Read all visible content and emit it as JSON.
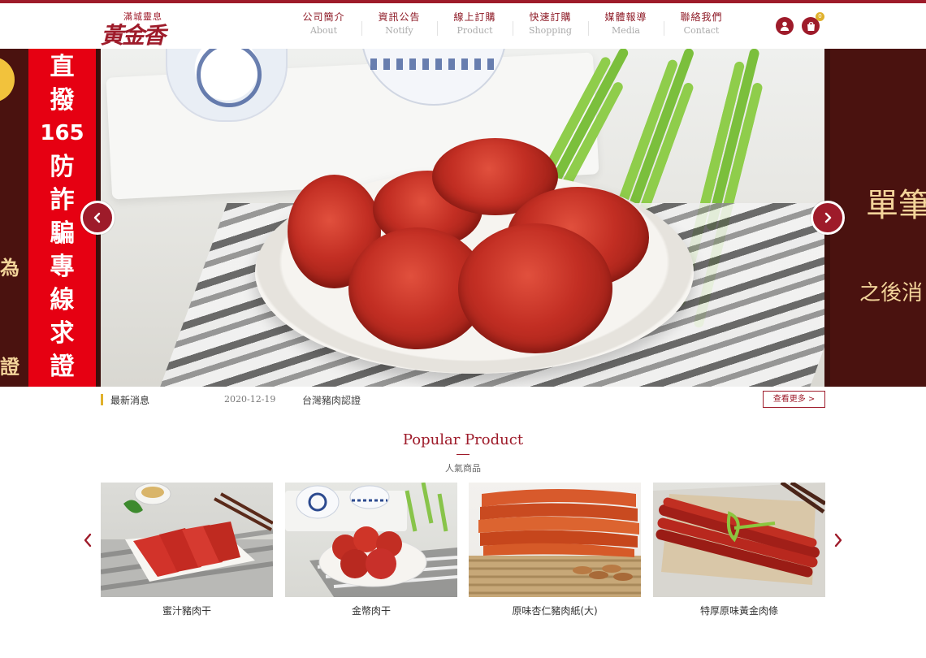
{
  "brand": {
    "small": "滿城靈息",
    "name": "黃金香"
  },
  "nav": [
    {
      "zh": "公司簡介",
      "en": "About"
    },
    {
      "zh": "資訊公告",
      "en": "Notify"
    },
    {
      "zh": "線上訂購",
      "en": "Product"
    },
    {
      "zh": "快速訂購",
      "en": "Shopping"
    },
    {
      "zh": "媒體報導",
      "en": "Media"
    },
    {
      "zh": "聯絡我們",
      "en": "Contact"
    }
  ],
  "cart": {
    "count": "0"
  },
  "hero": {
    "left_banner_chars": [
      "直",
      "撥",
      "165",
      "防",
      "詐",
      "騙",
      "專",
      "線",
      "求",
      "證"
    ],
    "left_side_chars": [
      "為",
      "證"
    ],
    "right_text_1": "單筆",
    "right_text_2": "之後消"
  },
  "news": {
    "label": "最新消息",
    "date": "2020-12-19",
    "text": "台灣豬肉認證",
    "more": "查看更多 >"
  },
  "popular": {
    "title": "Popular Product",
    "subtitle": "人氣商品",
    "products": [
      {
        "name": "蜜汁豬肉干"
      },
      {
        "name": "金幣肉干"
      },
      {
        "name": "原味杏仁豬肉紙(大)"
      },
      {
        "name": "特厚原味黃金肉條"
      }
    ]
  },
  "colors": {
    "brand_red": "#9e1b2a",
    "accent_gold": "#e0b12c",
    "banner_red": "#e60012"
  }
}
